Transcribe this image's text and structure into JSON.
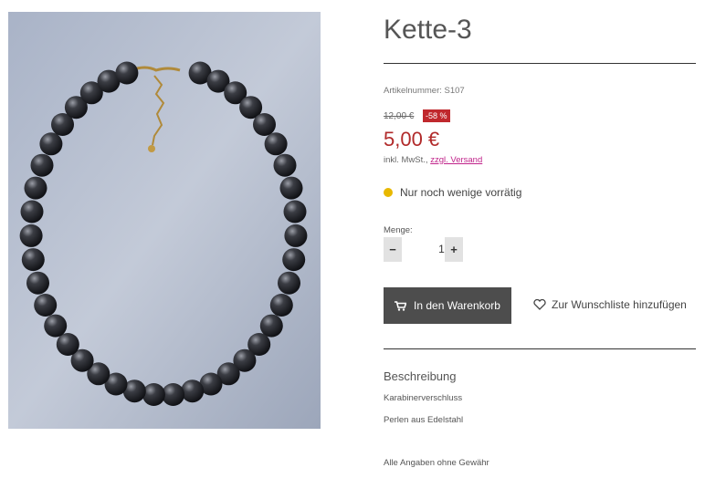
{
  "product": {
    "title": "Kette-3",
    "sku": "Artikelnummer: S107",
    "old_price": "12,00 €",
    "discount_badge": "-58 %",
    "price": "5,00 €",
    "tax_prefix": "inkl. MwSt., ",
    "shipping_link": "zzgl. Versand",
    "stock_status": "Nur noch wenige vorrätig",
    "stock_color": "#e8b800",
    "price_color": "#b12a2a"
  },
  "quantity": {
    "label": "Menge:",
    "minus": "−",
    "value": "1",
    "plus": "+"
  },
  "actions": {
    "add_to_cart": "In den Warenkorb",
    "wishlist": "Zur Wunschliste hinzufügen"
  },
  "description": {
    "heading": "Beschreibung",
    "lines": [
      "Karabinerverschluss",
      "Perlen aus Edelstahl"
    ],
    "disclaimer": "Alle Angaben ohne Gewähr"
  },
  "image": {
    "icon": "necklace-photo"
  }
}
